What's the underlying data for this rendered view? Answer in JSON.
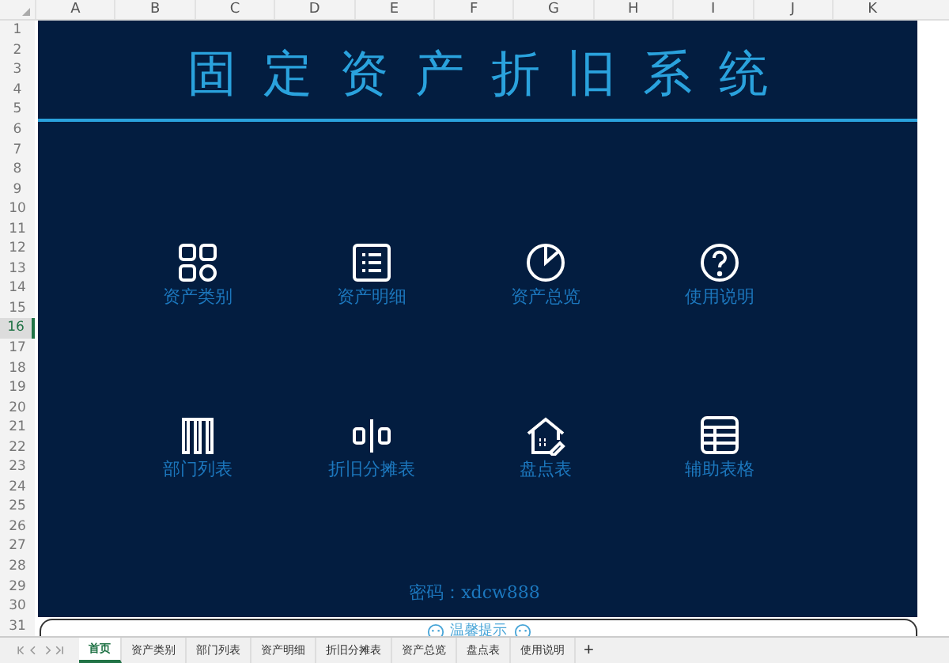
{
  "sheet": {
    "columns": [
      "A",
      "B",
      "C",
      "D",
      "E",
      "F",
      "G",
      "H",
      "I",
      "J",
      "K"
    ],
    "rows": [
      {
        "label": "1",
        "selected": false
      },
      {
        "label": "2",
        "selected": false
      },
      {
        "label": "3",
        "selected": false
      },
      {
        "label": "4",
        "selected": false
      },
      {
        "label": "5",
        "selected": false
      },
      {
        "label": "6",
        "selected": false
      },
      {
        "label": "7",
        "selected": false
      },
      {
        "label": "8",
        "selected": false
      },
      {
        "label": "9",
        "selected": false
      },
      {
        "label": "10",
        "selected": false
      },
      {
        "label": "11",
        "selected": false
      },
      {
        "label": "12",
        "selected": false
      },
      {
        "label": "13",
        "selected": false
      },
      {
        "label": "14",
        "selected": false
      },
      {
        "label": "15",
        "selected": false
      },
      {
        "label": "16",
        "selected": true
      },
      {
        "label": "17",
        "selected": false
      },
      {
        "label": "18",
        "selected": false
      },
      {
        "label": "19",
        "selected": false
      },
      {
        "label": "20",
        "selected": false
      },
      {
        "label": "21",
        "selected": false
      },
      {
        "label": "22",
        "selected": false
      },
      {
        "label": "23",
        "selected": false
      },
      {
        "label": "24",
        "selected": false
      },
      {
        "label": "25",
        "selected": false
      },
      {
        "label": "26",
        "selected": false
      },
      {
        "label": "27",
        "selected": false
      },
      {
        "label": "28",
        "selected": false
      },
      {
        "label": "29",
        "selected": false
      },
      {
        "label": "30",
        "selected": false
      },
      {
        "label": "31",
        "selected": false
      }
    ]
  },
  "dashboard": {
    "title": "固定资产折旧系统",
    "menu": [
      {
        "label": "资产类别",
        "kind": "grid"
      },
      {
        "label": "资产明细",
        "kind": "list"
      },
      {
        "label": "资产总览",
        "kind": "pie"
      },
      {
        "label": "使用说明",
        "kind": "help"
      },
      {
        "label": "部门列表",
        "kind": "org"
      },
      {
        "label": "折旧分摊表",
        "kind": "split"
      },
      {
        "label": "盘点表",
        "kind": "house"
      },
      {
        "label": "辅助表格",
        "kind": "table"
      }
    ],
    "password": "密码：xdcw888"
  },
  "notice": {
    "title": "温馨提示"
  },
  "sheet_tabs": [
    {
      "label": "首页",
      "selected": true
    },
    {
      "label": "资产类别",
      "selected": false
    },
    {
      "label": "部门列表",
      "selected": false
    },
    {
      "label": "资产明细",
      "selected": false
    },
    {
      "label": "折旧分摊表",
      "selected": false
    },
    {
      "label": "资产总览",
      "selected": false
    },
    {
      "label": "盘点表",
      "selected": false
    },
    {
      "label": "使用说明",
      "selected": false
    }
  ],
  "add_tab": "+"
}
